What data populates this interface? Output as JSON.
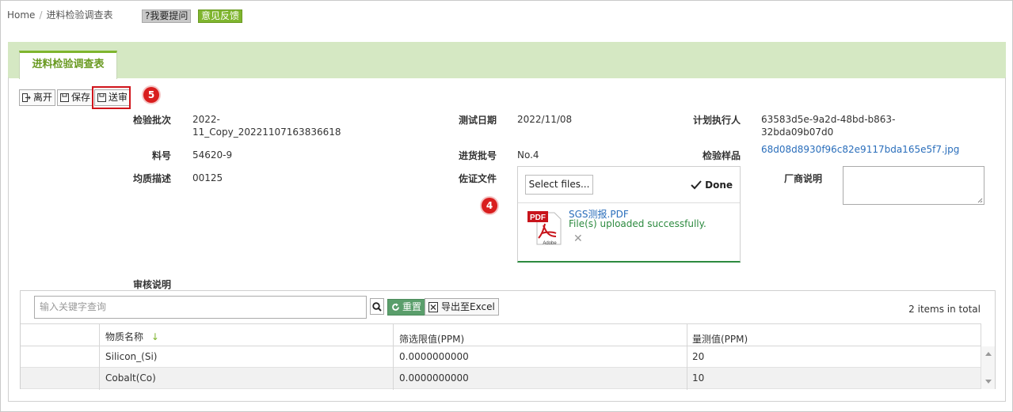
{
  "breadcrumb": {
    "home": "Home",
    "sep": "/",
    "current": "进料检验调查表"
  },
  "header_buttons": {
    "help": "?我要提问",
    "feedback": "意见反馈"
  },
  "tab": {
    "label": "进料检验调查表"
  },
  "toolbar": {
    "leave": "离开",
    "save": "保存",
    "submit": "送审"
  },
  "steps": {
    "submit_step": "5",
    "upload_step": "4"
  },
  "form": {
    "batch_label": "检验批次",
    "batch_value_1": "2022-",
    "batch_value_2": "11_Copy_20221107163836618",
    "test_date_label": "测试日期",
    "test_date_value": "2022/11/08",
    "planner_label": "计划执行人",
    "planner_value_1": "63583d5e-9a2d-48bd-b863-",
    "planner_value_2": "32bda09b07d0",
    "material_label": "料号",
    "material_value": "54620-9",
    "incoming_label": "进货批号",
    "incoming_value": "No.4",
    "sample_label": "检验样品",
    "sample_value": "68d08d8930f96c82e9117bda165e5f7.jpg",
    "homog_label": "均质描述",
    "homog_value": "00125",
    "evidence_label": "佐证文件",
    "vendor_label": "厂商说明",
    "review_label": "审核说明"
  },
  "upload": {
    "select_label": "Select files...",
    "done_label": "Done",
    "file_name": "SGS测报.PDF",
    "file_status": "File(s) uploaded successfully.",
    "pdf_badge": "PDF",
    "pdf_brand": "Adobe"
  },
  "grid": {
    "search_placeholder": "输入关键字查询",
    "reset_label": "重置",
    "excel_label": "导出至Excel",
    "count": "2 items in total",
    "columns": [
      "物质名称",
      "筛选限值(PPM)",
      "量测值(PPM)"
    ],
    "rows": [
      [
        "Silicon_(Si)",
        "0.0000000000",
        "20"
      ],
      [
        "Cobalt(Co)",
        "0.0000000000",
        "10"
      ]
    ]
  },
  "colors": {
    "accent_green": "#7fb52e",
    "tab_bar": "#d5e8c3",
    "highlight_red": "#d0141b",
    "success": "#2c8a3f",
    "link": "#2a6ebb"
  }
}
